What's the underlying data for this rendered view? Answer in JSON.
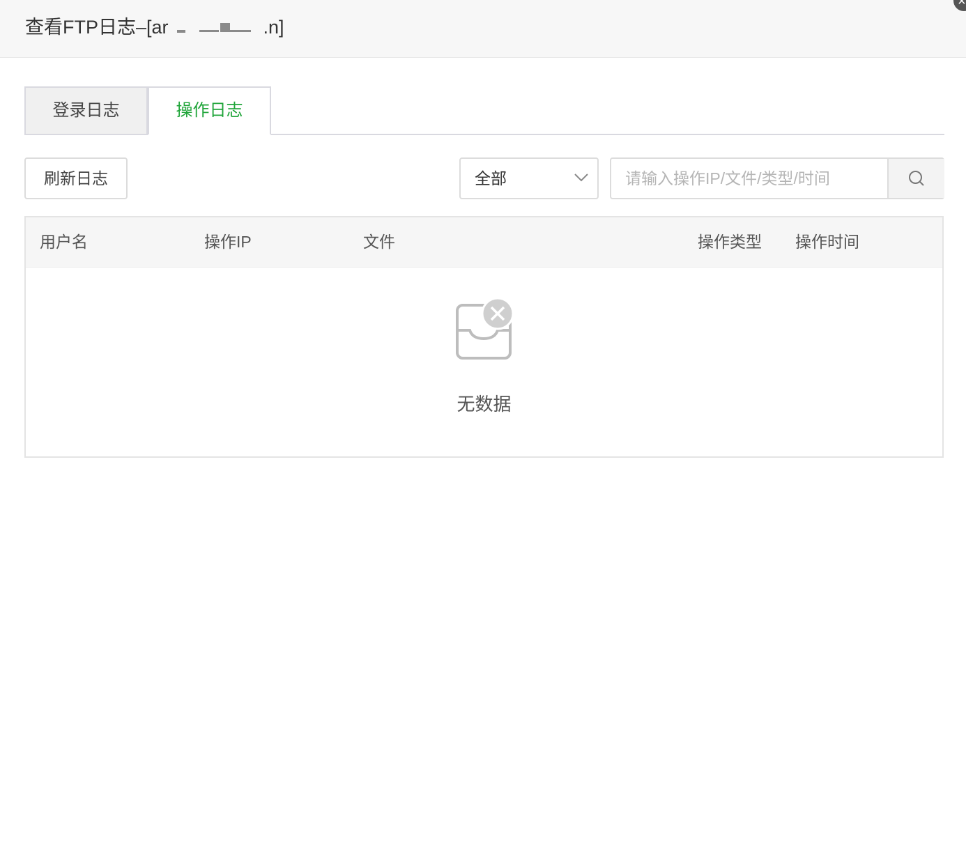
{
  "dialog": {
    "title_prefix": "查看FTP日志–[ar",
    "title_suffix": ".n]"
  },
  "tabs": [
    {
      "label": "登录日志",
      "active": false
    },
    {
      "label": "操作日志",
      "active": true
    }
  ],
  "toolbar": {
    "refresh_label": "刷新日志",
    "filter_value": "全部",
    "search_placeholder": "请输入操作IP/文件/类型/时间"
  },
  "table": {
    "columns": [
      "用户名",
      "操作IP",
      "文件",
      "操作类型",
      "操作时间"
    ],
    "rows": [],
    "empty_text": "无数据"
  },
  "icons": [
    "chevron-down-icon",
    "search-icon",
    "empty-inbox-icon",
    "close-icon"
  ],
  "colors": {
    "accent": "#20a53a",
    "header_bg": "#f7f7f7"
  }
}
